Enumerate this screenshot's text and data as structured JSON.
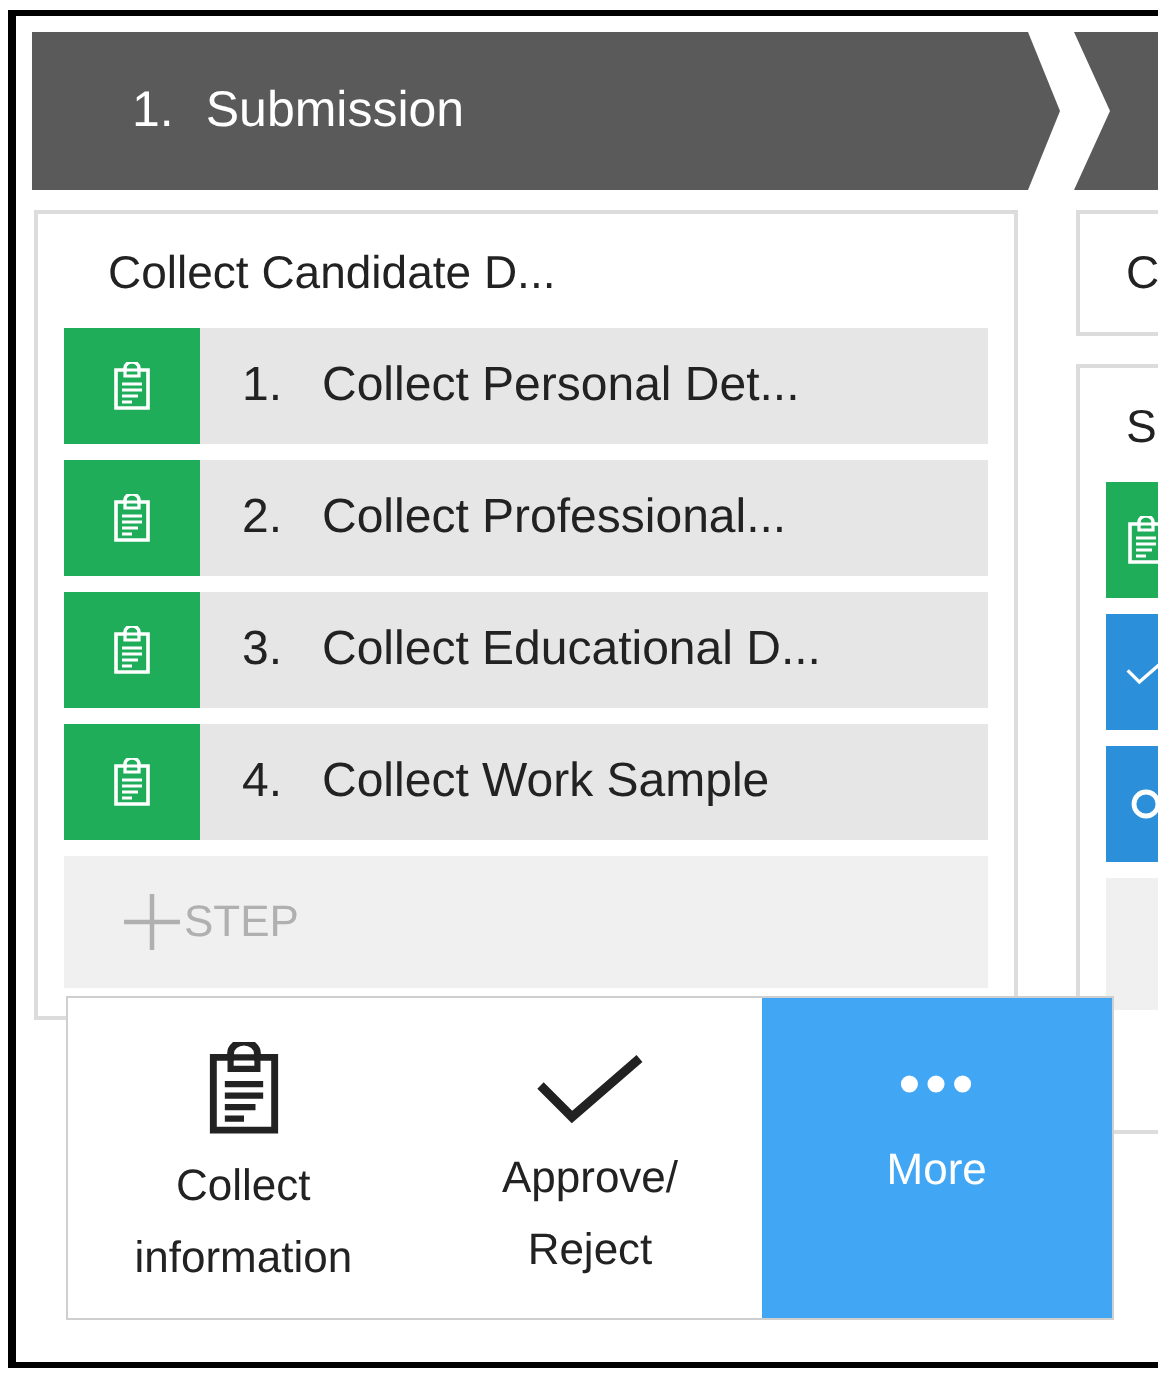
{
  "stages": [
    {
      "number": "1.",
      "name": "Submission",
      "processes": [
        {
          "title": "Collect Candidate D...",
          "steps": [
            {
              "kind": "collect",
              "number": "1.",
              "label": "Collect Personal Det..."
            },
            {
              "kind": "collect",
              "number": "2.",
              "label": "Collect Professional..."
            },
            {
              "kind": "collect",
              "number": "3.",
              "label": "Collect Educational D..."
            },
            {
              "kind": "collect",
              "number": "4.",
              "label": "Collect Work Sample"
            }
          ],
          "add_step": {
            "label": "STEP"
          }
        }
      ]
    },
    {
      "processes": [
        {
          "title": "C"
        },
        {
          "title": "S",
          "steps": [
            {
              "kind": "collect"
            },
            {
              "kind": "approve"
            },
            {
              "kind": "utility"
            }
          ],
          "add_step_row": true
        }
      ]
    }
  ],
  "step_menu": {
    "items": [
      {
        "kind": "collect",
        "lines": [
          "Collect",
          "information"
        ],
        "selected": false
      },
      {
        "kind": "approve",
        "lines": [
          "Approve/",
          "Reject"
        ],
        "selected": false
      },
      {
        "kind": "more",
        "lines": [
          "More"
        ],
        "selected": true
      }
    ]
  }
}
